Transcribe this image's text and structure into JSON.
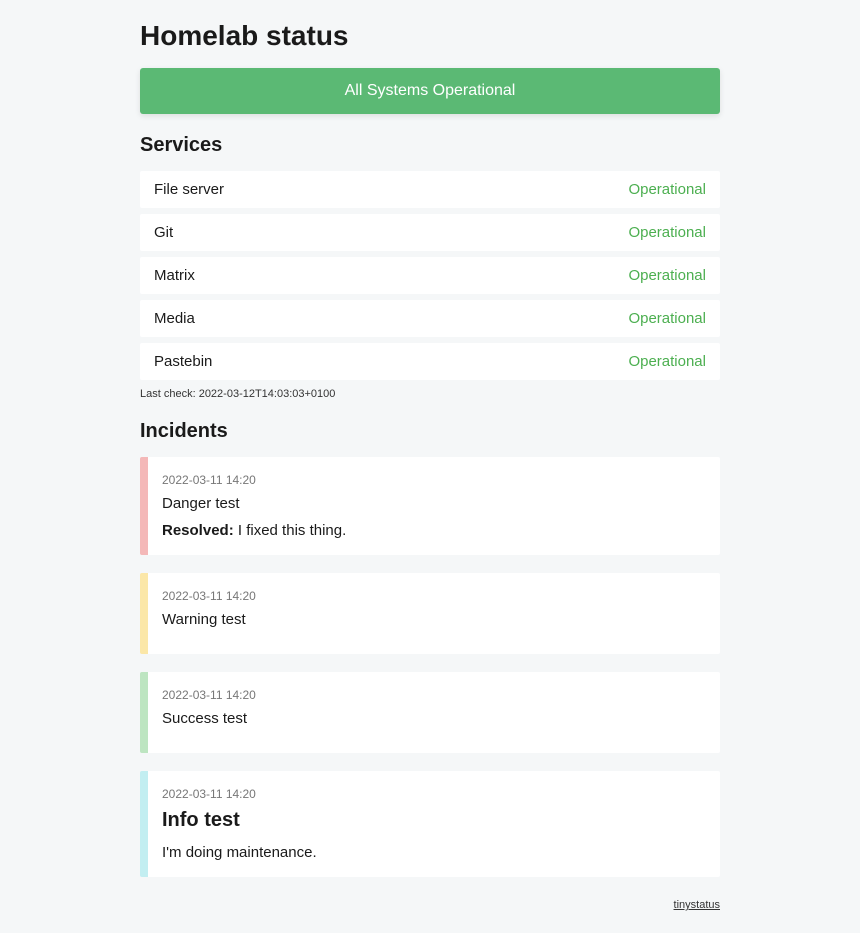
{
  "page_title": "Homelab status",
  "banner": "All Systems Operational",
  "services_heading": "Services",
  "services": [
    {
      "name": "File server",
      "status": "Operational"
    },
    {
      "name": "Git",
      "status": "Operational"
    },
    {
      "name": "Matrix",
      "status": "Operational"
    },
    {
      "name": "Media",
      "status": "Operational"
    },
    {
      "name": "Pastebin",
      "status": "Operational"
    }
  ],
  "last_check": "Last check: 2022-03-12T14:03:03+0100",
  "incidents_heading": "Incidents",
  "incidents": [
    {
      "type": "danger",
      "date": "2022-03-11 14:20",
      "title": "Danger test",
      "resolved_label": "Resolved:",
      "resolved_text": "I fixed this thing."
    },
    {
      "type": "warning",
      "date": "2022-03-11 14:20",
      "title": "Warning test"
    },
    {
      "type": "success",
      "date": "2022-03-11 14:20",
      "title": "Success test"
    },
    {
      "type": "info",
      "date": "2022-03-11 14:20",
      "title_h2": "Info test",
      "body": "I'm doing maintenance."
    }
  ],
  "footer_link": "tinystatus"
}
